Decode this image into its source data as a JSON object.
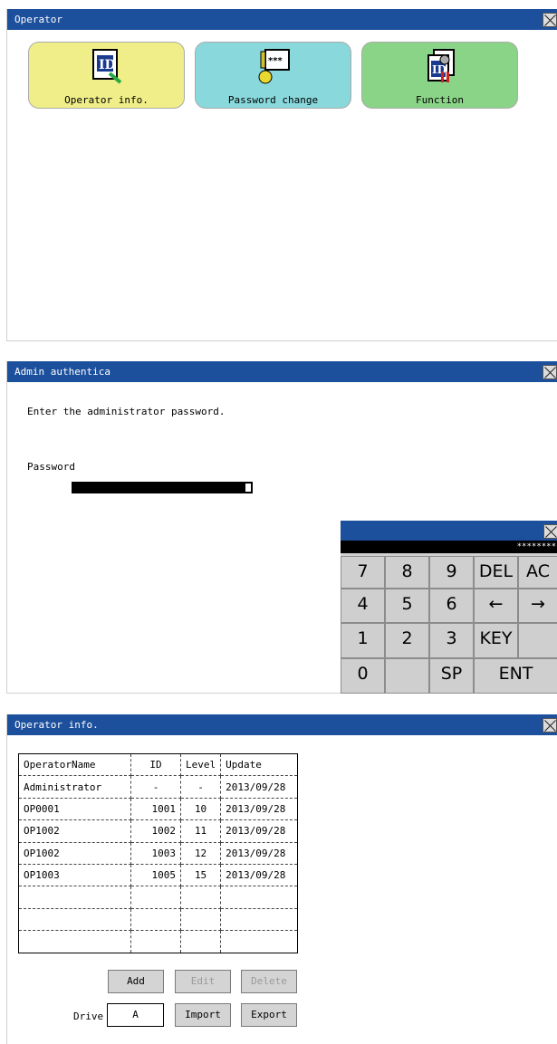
{
  "panel1": {
    "title": "Operator",
    "buttons": [
      {
        "label": "Operator info.",
        "color": "#f0ee88"
      },
      {
        "label": "Password change",
        "color": "#88d8dc"
      },
      {
        "label": "Function",
        "color": "#8ad488"
      }
    ]
  },
  "panel2": {
    "title": "Admin authentica",
    "instruction": "Enter the administrator password.",
    "password_label": "Password",
    "keypad": {
      "display": "********",
      "keys": [
        "7",
        "8",
        "9",
        "DEL",
        "AC",
        "4",
        "5",
        "6",
        "←",
        "→",
        "1",
        "2",
        "3",
        "KEY",
        "",
        "0",
        "",
        "SP",
        "ENT"
      ]
    }
  },
  "panel3": {
    "title": "Operator info.",
    "table": {
      "headers": [
        "OperatorName",
        "ID",
        "Level",
        "Update"
      ],
      "rows": [
        [
          "Administrator",
          "-",
          "-",
          "2013/09/28"
        ],
        [
          "OP0001",
          "1001",
          "10",
          "2013/09/28"
        ],
        [
          "OP1002",
          "1002",
          "11",
          "2013/09/28"
        ],
        [
          "OP1002",
          "1003",
          "12",
          "2013/09/28"
        ],
        [
          "OP1003",
          "1005",
          "15",
          "2013/09/28"
        ],
        [
          "",
          "",
          "",
          ""
        ],
        [
          "",
          "",
          "",
          ""
        ],
        [
          "",
          "",
          "",
          ""
        ]
      ]
    },
    "add_label": "Add",
    "edit_label": "Edit",
    "delete_label": "Delete",
    "drive_label": "Drive",
    "drive_value": "A",
    "import_label": "Import",
    "export_label": "Export"
  }
}
